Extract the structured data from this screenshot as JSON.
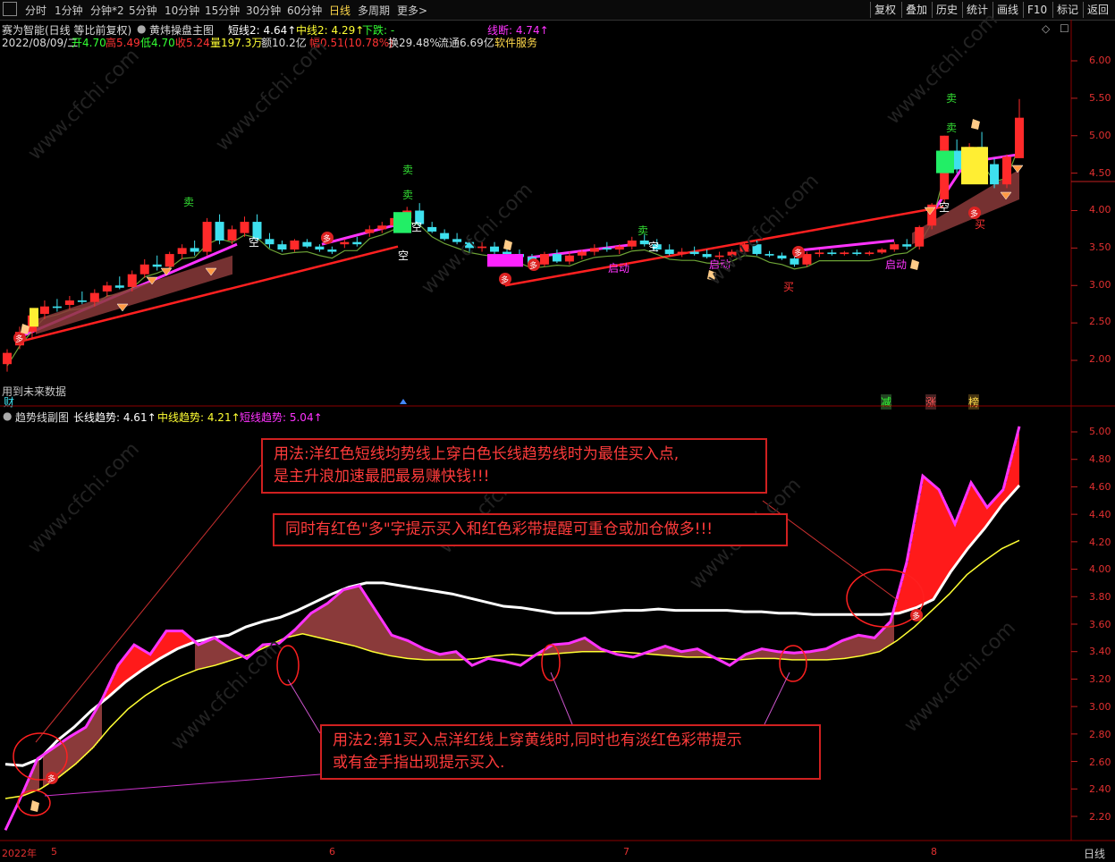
{
  "toolbar": {
    "periods": [
      "分时",
      "1分钟",
      "分钟*2",
      "5分钟",
      "10分钟",
      "15分钟",
      "30分钟",
      "60分钟",
      "日线",
      "多周期",
      "更多>"
    ],
    "active_period": "日线",
    "right_buttons": [
      "复权",
      "叠加",
      "历史",
      "统计",
      "画线",
      "F10",
      "标记",
      "返回"
    ]
  },
  "main": {
    "stock_title": "赛为智能(日线 等比前复权)",
    "indicator_name": "黄炜操盘主图",
    "short_line": "短线2: 4.64↑",
    "mid_line": "中线2: 4.29↑",
    "down_label": "下跌: -",
    "break_line": "线断: 4.74↑",
    "date": "2022/08/09/二",
    "open": "开4.70",
    "high": "高5.49",
    "low": "低4.70",
    "close": "收5.24",
    "volume": "量197.3万",
    "amount": "额10.2亿",
    "change": "幅0.51(10.78%)",
    "turnover": "换29.48%",
    "float": "流通6.69亿",
    "sector": "软件服务",
    "future_note": "用到未来数据",
    "cai": "财",
    "tag_jian": "减",
    "tag_zhang": "涨",
    "tag_bang": "榜",
    "labels": {
      "sell": "卖",
      "empty": "空",
      "buy": "买",
      "start": "启动",
      "duo": "多"
    },
    "y_ticks": [
      "6.00",
      "5.50",
      "5.00",
      "4.50",
      "4.00",
      "3.50",
      "3.00",
      "2.50",
      "2.00"
    ]
  },
  "sub": {
    "title": "趋势线副图",
    "long_trend": "长线趋势: 4.61↑",
    "mid_trend": "中线趋势: 4.21↑",
    "short_trend": "短线趋势: 5.04↑",
    "y_ticks": [
      "5.00",
      "4.80",
      "4.60",
      "4.40",
      "4.20",
      "4.00",
      "3.80",
      "3.60",
      "3.40",
      "3.20",
      "3.00",
      "2.80",
      "2.60",
      "2.40",
      "2.20"
    ],
    "annotation1_line1": "用法:洋红色短线均势线上穿白色长线趋势线时为最佳买入点,",
    "annotation1_line2": "是主升浪加速最肥最易赚快钱!!!",
    "annotation2": "同时有红色\"多\"字提示买入和红色彩带提醒可重仓或加仓做多!!!",
    "annotation3_line1": "用法2:第1买入点洋红线上穿黄线时,同时也有淡红色彩带提示",
    "annotation3_line2": "或有金手指出现提示买入."
  },
  "dates": [
    "2022年",
    "5",
    "6",
    "7",
    "8"
  ],
  "period_label": "日线",
  "watermark": "www.cfchi.com",
  "colors": {
    "up": "#ff2a2a",
    "down": "#3ee0ee",
    "magenta": "#ff33ff",
    "yellow": "#ffff33",
    "white": "#ffffff",
    "band": "#8a3a3a"
  },
  "chart_data": [
    {
      "type": "candlestick",
      "title": "黄炜操盘主图",
      "ylim": [
        1.8,
        6.2
      ],
      "candles": [
        [
          1.95,
          2.15,
          1.85,
          2.1
        ],
        [
          2.2,
          2.45,
          2.15,
          2.38
        ],
        [
          2.38,
          2.62,
          2.3,
          2.6
        ],
        [
          2.62,
          2.8,
          2.55,
          2.72
        ],
        [
          2.72,
          2.82,
          2.65,
          2.7
        ],
        [
          2.74,
          2.86,
          2.68,
          2.8
        ],
        [
          2.8,
          2.92,
          2.75,
          2.78
        ],
        [
          2.78,
          2.95,
          2.72,
          2.9
        ],
        [
          2.92,
          3.05,
          2.85,
          3.0
        ],
        [
          3.0,
          3.12,
          2.95,
          2.97
        ],
        [
          2.98,
          3.2,
          2.92,
          3.15
        ],
        [
          3.15,
          3.35,
          3.1,
          3.28
        ],
        [
          3.28,
          3.4,
          3.2,
          3.25
        ],
        [
          3.25,
          3.45,
          3.18,
          3.42
        ],
        [
          3.42,
          3.55,
          3.35,
          3.5
        ],
        [
          3.5,
          3.6,
          3.4,
          3.45
        ],
        [
          3.45,
          3.9,
          3.4,
          3.85
        ],
        [
          3.85,
          3.95,
          3.55,
          3.6
        ],
        [
          3.6,
          3.8,
          3.55,
          3.75
        ],
        [
          3.7,
          3.92,
          3.65,
          3.85
        ],
        [
          3.85,
          3.95,
          3.6,
          3.62
        ],
        [
          3.62,
          3.7,
          3.5,
          3.55
        ],
        [
          3.55,
          3.6,
          3.45,
          3.48
        ],
        [
          3.48,
          3.62,
          3.45,
          3.6
        ],
        [
          3.58,
          3.62,
          3.5,
          3.52
        ],
        [
          3.52,
          3.55,
          3.45,
          3.48
        ],
        [
          3.48,
          3.52,
          3.42,
          3.45
        ],
        [
          3.55,
          3.62,
          3.5,
          3.58
        ],
        [
          3.58,
          3.65,
          3.52,
          3.55
        ],
        [
          3.7,
          3.8,
          3.65,
          3.75
        ],
        [
          3.75,
          3.85,
          3.7,
          3.8
        ],
        [
          3.8,
          3.95,
          3.75,
          3.9
        ],
        [
          3.9,
          4.05,
          3.85,
          4.0
        ],
        [
          4.0,
          4.1,
          3.78,
          3.82
        ],
        [
          3.78,
          3.85,
          3.7,
          3.72
        ],
        [
          3.7,
          3.75,
          3.6,
          3.62
        ],
        [
          3.62,
          3.7,
          3.55,
          3.58
        ],
        [
          3.58,
          3.62,
          3.45,
          3.5
        ],
        [
          3.5,
          3.58,
          3.45,
          3.52
        ],
        [
          3.52,
          3.58,
          3.42,
          3.45
        ],
        [
          3.45,
          3.5,
          3.38,
          3.42
        ],
        [
          3.42,
          3.48,
          3.35,
          3.38
        ],
        [
          3.38,
          3.42,
          3.25,
          3.28
        ],
        [
          3.28,
          3.45,
          3.25,
          3.42
        ],
        [
          3.42,
          3.48,
          3.3,
          3.32
        ],
        [
          3.32,
          3.45,
          3.28,
          3.4
        ],
        [
          3.4,
          3.48,
          3.35,
          3.45
        ],
        [
          3.45,
          3.55,
          3.4,
          3.5
        ],
        [
          3.5,
          3.58,
          3.45,
          3.48
        ],
        [
          3.48,
          3.55,
          3.42,
          3.52
        ],
        [
          3.52,
          3.65,
          3.48,
          3.6
        ],
        [
          3.6,
          3.68,
          3.52,
          3.55
        ],
        [
          3.55,
          3.62,
          3.45,
          3.48
        ],
        [
          3.48,
          3.55,
          3.4,
          3.42
        ],
        [
          3.42,
          3.5,
          3.38,
          3.45
        ],
        [
          3.45,
          3.52,
          3.4,
          3.42
        ],
        [
          3.42,
          3.48,
          3.36,
          3.38
        ],
        [
          3.38,
          3.45,
          3.35,
          3.4
        ],
        [
          3.4,
          3.48,
          3.38,
          3.45
        ],
        [
          3.45,
          3.58,
          3.42,
          3.55
        ],
        [
          3.55,
          3.6,
          3.4,
          3.42
        ],
        [
          3.42,
          3.46,
          3.38,
          3.4
        ],
        [
          3.4,
          3.44,
          3.34,
          3.36
        ],
        [
          3.36,
          3.4,
          3.25,
          3.28
        ],
        [
          3.28,
          3.45,
          3.25,
          3.42
        ],
        [
          3.42,
          3.48,
          3.38,
          3.44
        ],
        [
          3.44,
          3.48,
          3.4,
          3.42
        ],
        [
          3.42,
          3.46,
          3.4,
          3.44
        ],
        [
          3.44,
          3.48,
          3.4,
          3.42
        ],
        [
          3.42,
          3.46,
          3.4,
          3.44
        ],
        [
          3.44,
          3.5,
          3.42,
          3.48
        ],
        [
          3.48,
          3.58,
          3.45,
          3.55
        ],
        [
          3.55,
          3.62,
          3.48,
          3.52
        ],
        [
          3.52,
          3.8,
          3.48,
          3.78
        ],
        [
          3.8,
          4.1,
          3.75,
          4.08
        ],
        [
          4.15,
          5.0,
          4.1,
          5.0
        ],
        [
          4.8,
          4.95,
          4.5,
          4.55
        ],
        [
          4.55,
          4.9,
          4.4,
          4.85
        ],
        [
          4.85,
          5.05,
          4.6,
          4.62
        ],
        [
          4.62,
          4.7,
          4.3,
          4.35
        ],
        [
          4.35,
          4.75,
          4.3,
          4.72
        ],
        [
          4.7,
          5.49,
          4.7,
          5.24
        ]
      ]
    },
    {
      "type": "line",
      "title": "趋势线副图",
      "ylim": [
        2.1,
        5.1
      ],
      "series": [
        {
          "name": "长线趋势",
          "color": "white",
          "values": [
            2.58,
            2.57,
            2.62,
            2.75,
            2.85,
            2.97,
            3.07,
            3.18,
            3.27,
            3.35,
            3.42,
            3.47,
            3.5,
            3.52,
            3.58,
            3.62,
            3.65,
            3.7,
            3.76,
            3.82,
            3.87,
            3.9,
            3.9,
            3.88,
            3.86,
            3.84,
            3.82,
            3.79,
            3.76,
            3.73,
            3.72,
            3.7,
            3.68,
            3.68,
            3.68,
            3.69,
            3.7,
            3.7,
            3.71,
            3.7,
            3.7,
            3.7,
            3.7,
            3.69,
            3.69,
            3.68,
            3.68,
            3.67,
            3.67,
            3.67,
            3.67,
            3.67,
            3.68,
            3.72,
            3.78,
            3.98,
            4.15,
            4.3,
            4.47,
            4.61
          ]
        },
        {
          "name": "中线趋势",
          "color": "yellow",
          "values": [
            2.33,
            2.35,
            2.4,
            2.48,
            2.58,
            2.7,
            2.85,
            2.98,
            3.08,
            3.16,
            3.22,
            3.27,
            3.3,
            3.34,
            3.38,
            3.44,
            3.5,
            3.53,
            3.5,
            3.47,
            3.44,
            3.4,
            3.37,
            3.35,
            3.34,
            3.34,
            3.34,
            3.35,
            3.37,
            3.38,
            3.37,
            3.38,
            3.39,
            3.4,
            3.4,
            3.4,
            3.39,
            3.38,
            3.37,
            3.36,
            3.36,
            3.35,
            3.34,
            3.35,
            3.35,
            3.34,
            3.34,
            3.34,
            3.35,
            3.37,
            3.4,
            3.48,
            3.58,
            3.7,
            3.82,
            3.96,
            4.06,
            4.15,
            4.21
          ]
        },
        {
          "name": "短线趋势",
          "color": "magenta",
          "values": [
            2.1,
            2.35,
            2.62,
            2.7,
            2.78,
            2.85,
            3.05,
            3.3,
            3.45,
            3.38,
            3.55,
            3.55,
            3.45,
            3.5,
            3.42,
            3.35,
            3.45,
            3.46,
            3.56,
            3.68,
            3.75,
            3.85,
            3.88,
            3.7,
            3.52,
            3.48,
            3.42,
            3.38,
            3.4,
            3.3,
            3.35,
            3.33,
            3.3,
            3.38,
            3.45,
            3.46,
            3.5,
            3.42,
            3.38,
            3.36,
            3.4,
            3.44,
            3.4,
            3.42,
            3.36,
            3.3,
            3.38,
            3.42,
            3.4,
            3.39,
            3.4,
            3.42,
            3.48,
            3.52,
            3.5,
            3.62,
            4.05,
            4.68,
            4.58,
            4.33,
            4.63,
            4.45,
            4.58,
            5.04
          ]
        }
      ]
    }
  ]
}
